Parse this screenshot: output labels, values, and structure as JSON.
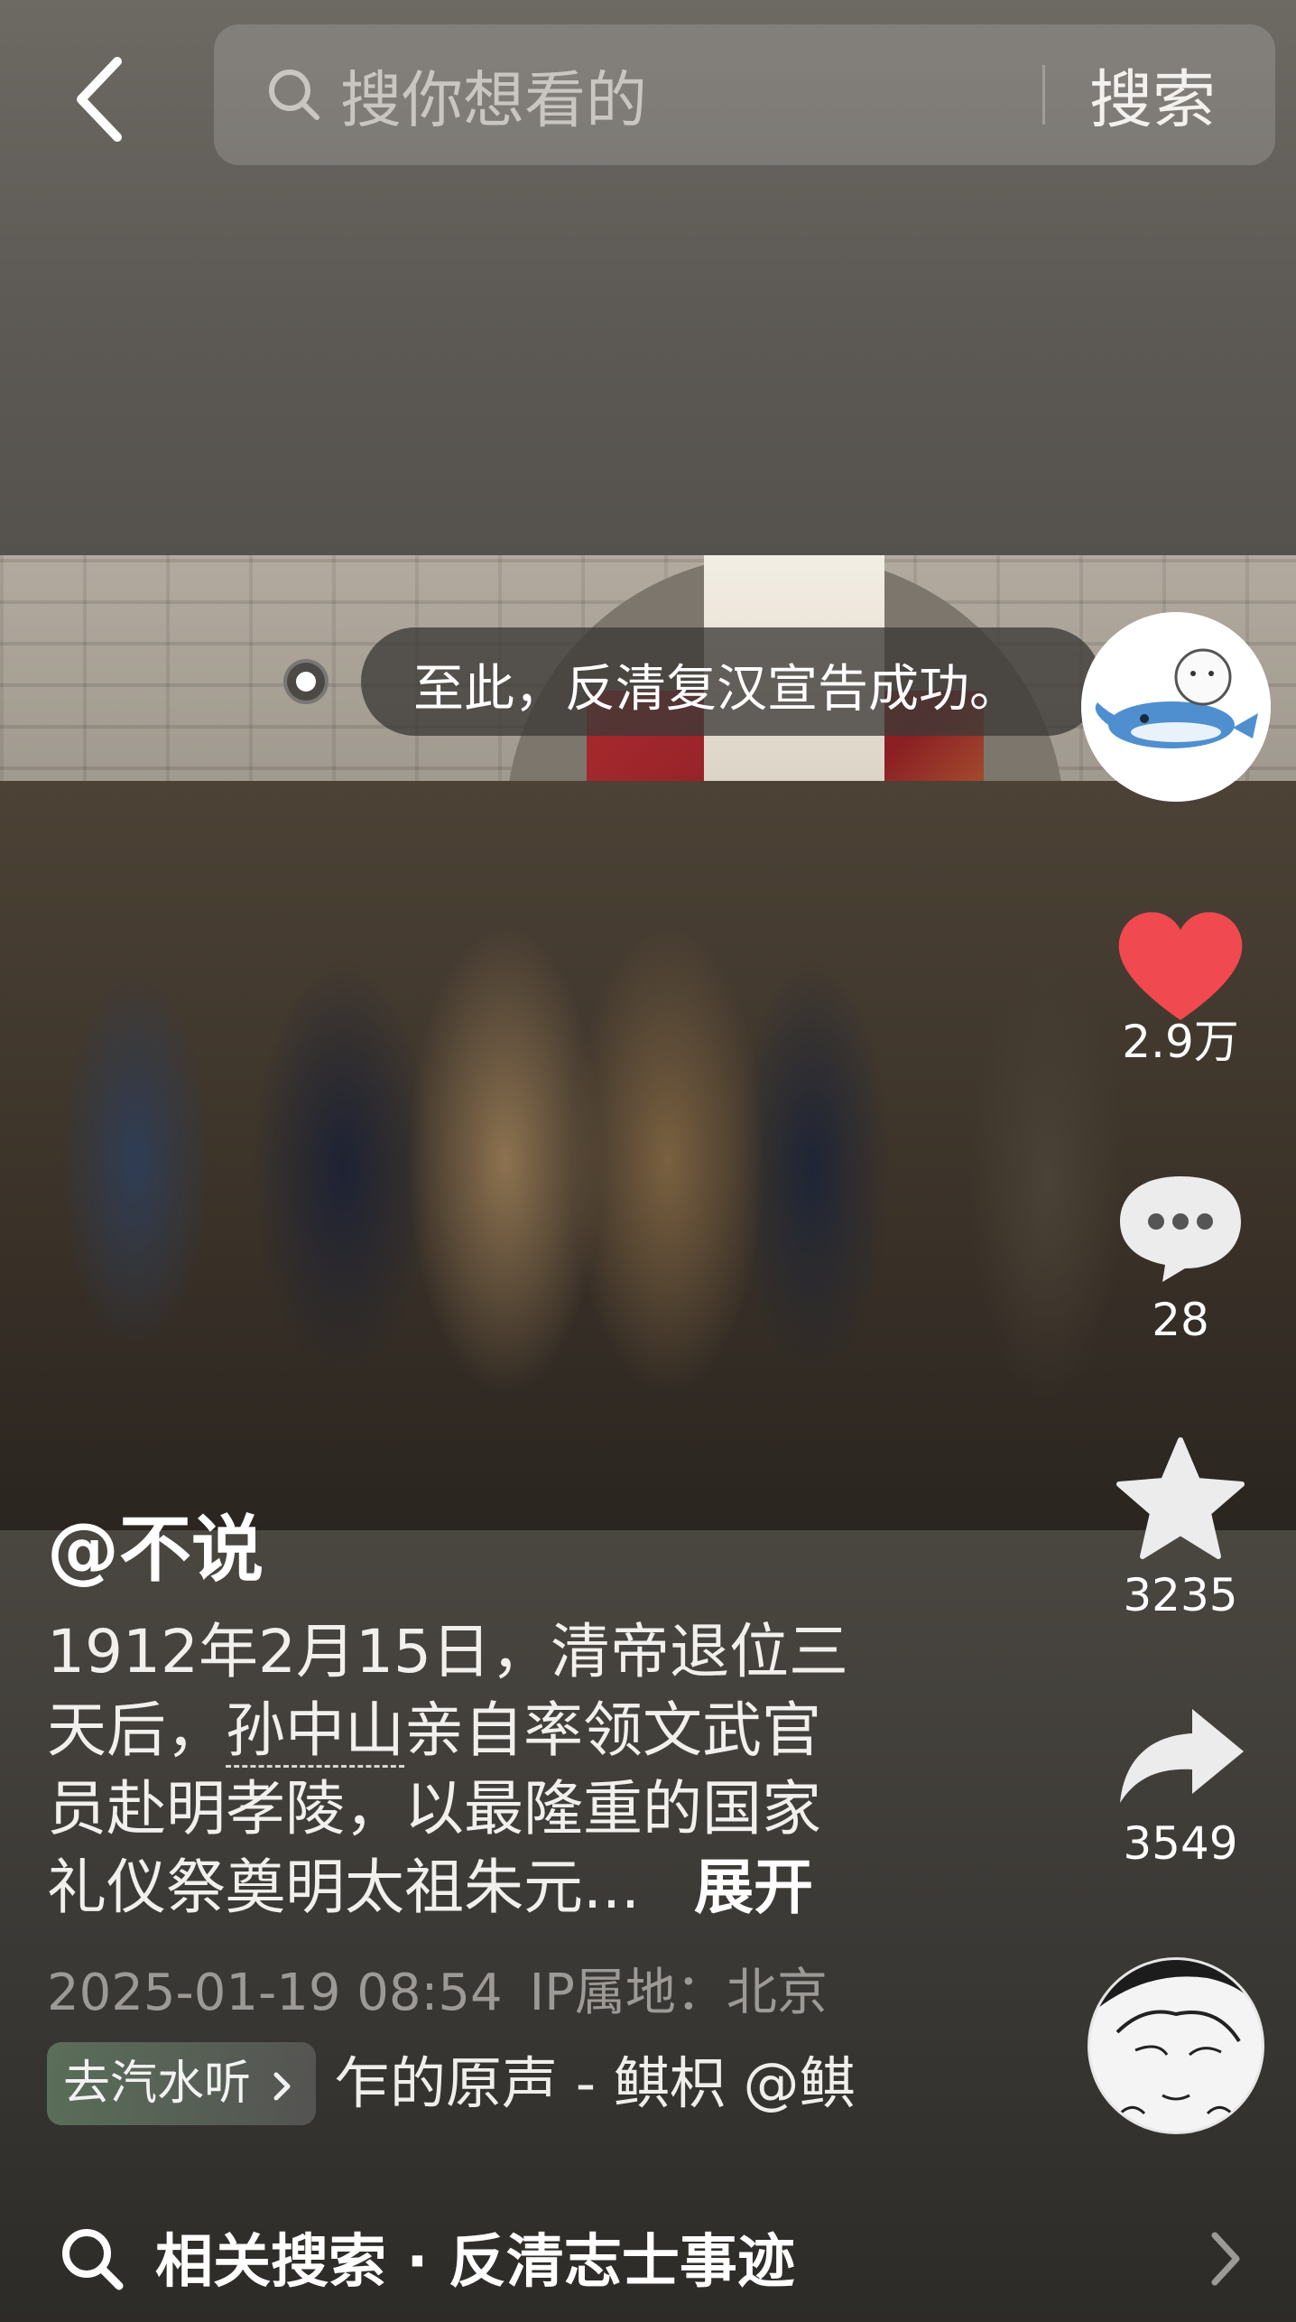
{
  "header": {
    "search_placeholder": "搜你想看的",
    "search_button": "搜索"
  },
  "video": {
    "caption": "至此，反清复汉宣告成功。"
  },
  "actions": {
    "likes": "2.9万",
    "comments": "28",
    "favorites": "3235",
    "shares": "3549"
  },
  "post": {
    "author": "@不说",
    "desc_line1": "1912年2月15日，清帝退位三",
    "desc_line2_pre": "天后，",
    "desc_keyword": "孙中山",
    "desc_line2_post": "亲自率领文武官",
    "desc_line3": "员赴明孝陵，以最隆重的国家",
    "desc_line4": "礼仪祭奠明太祖朱元...",
    "expand": "展开",
    "timestamp": "2025-01-19 08:54",
    "ip_location": "IP属地：北京"
  },
  "music": {
    "tag": "去汽水听",
    "text": "乍的原声 - 鲯枳     @鲯"
  },
  "related": {
    "text": "相关搜索 · 反清志士事迹"
  },
  "colors": {
    "like_heart": "#f0494f",
    "background": "#46443f"
  },
  "icons": [
    "back-arrow-icon",
    "search-icon",
    "heart-icon",
    "comment-icon",
    "star-icon",
    "share-icon",
    "chevron-right-icon"
  ]
}
